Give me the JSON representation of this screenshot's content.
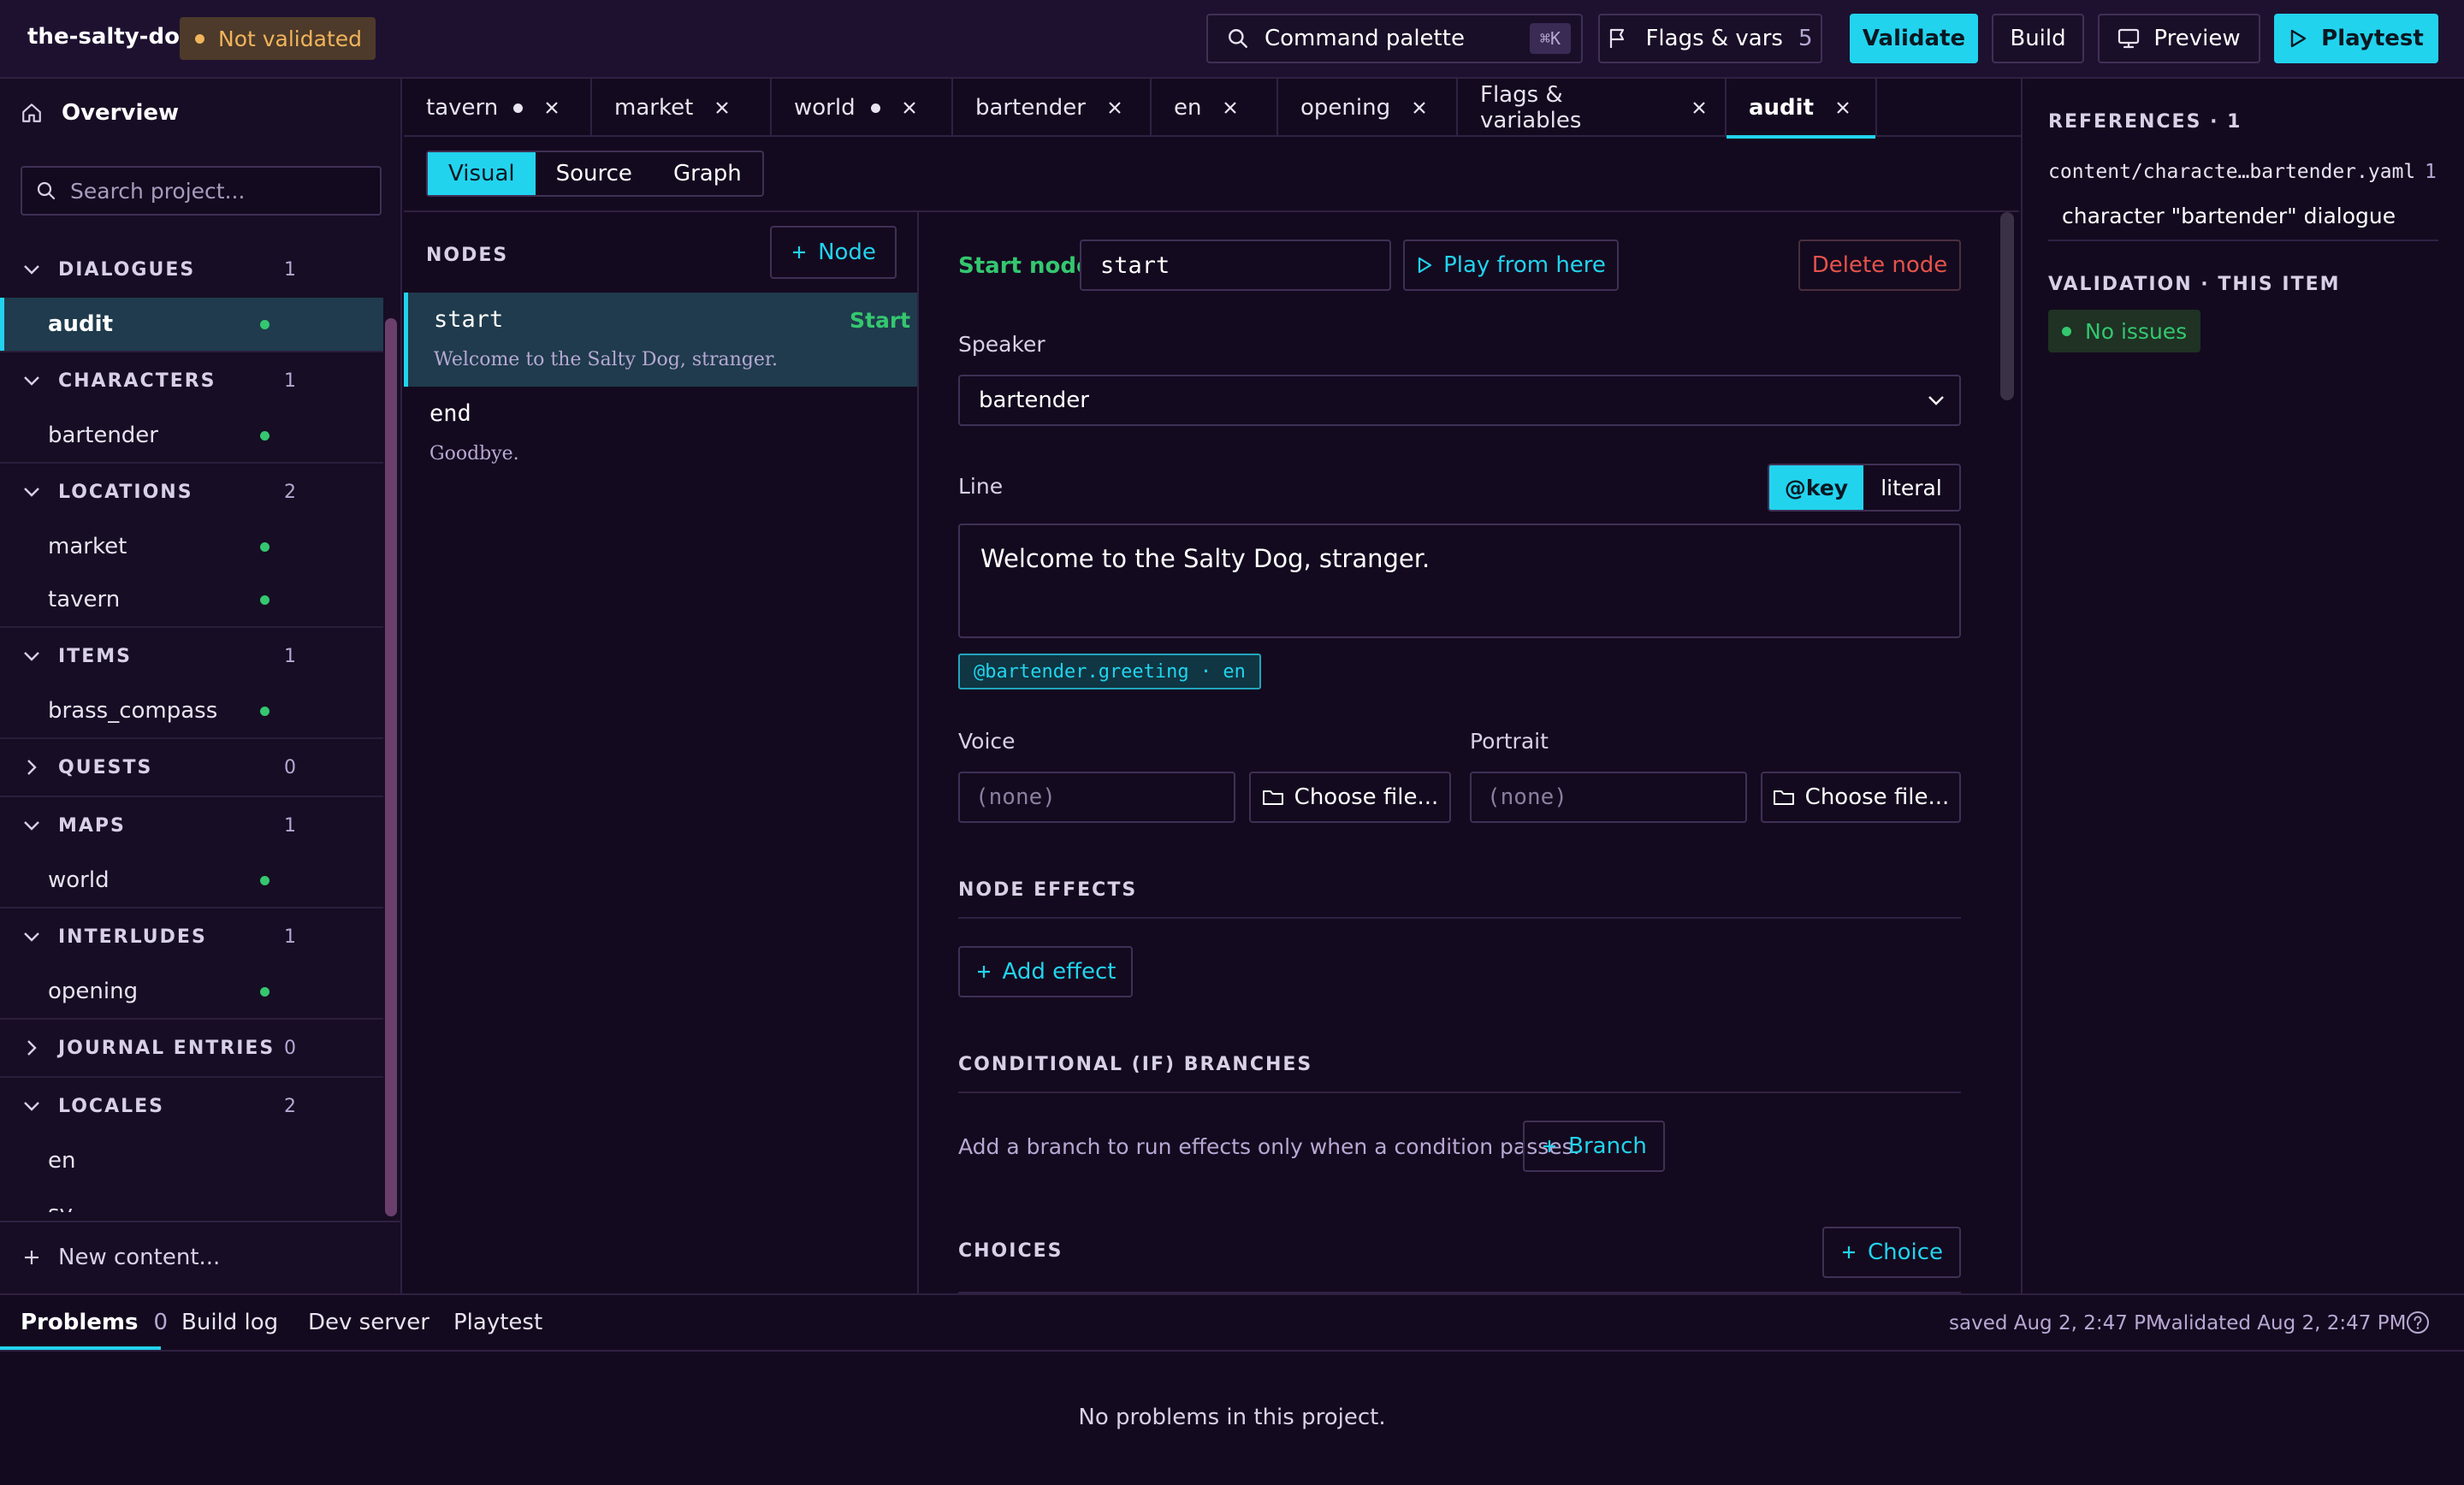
{
  "app": {
    "project_name": "the-salty-dog",
    "status_badge": "Not validated"
  },
  "toolbar": {
    "command_palette": "Command palette",
    "command_shortcut": "⌘K",
    "flags_label": "Flags & vars",
    "flags_count": "5",
    "validate_label": "Validate",
    "build_label": "Build",
    "preview_label": "Preview",
    "playtest_label": "Playtest"
  },
  "sidebar": {
    "overview": "Overview",
    "search_placeholder": "Search project...",
    "sections": [
      {
        "label": "DIALOGUES",
        "count": "1",
        "expanded": true,
        "items": [
          "audit"
        ]
      },
      {
        "label": "CHARACTERS",
        "count": "1",
        "expanded": true,
        "items": [
          "bartender"
        ]
      },
      {
        "label": "LOCATIONS",
        "count": "2",
        "expanded": true,
        "items": [
          "market",
          "tavern"
        ]
      },
      {
        "label": "ITEMS",
        "count": "1",
        "expanded": true,
        "items": [
          "brass_compass"
        ]
      },
      {
        "label": "QUESTS",
        "count": "0",
        "expanded": false,
        "items": []
      },
      {
        "label": "MAPS",
        "count": "1",
        "expanded": true,
        "items": [
          "world"
        ]
      },
      {
        "label": "INTERLUDES",
        "count": "1",
        "expanded": true,
        "items": [
          "opening"
        ]
      },
      {
        "label": "JOURNAL ENTRIES",
        "count": "0",
        "expanded": false,
        "items": []
      },
      {
        "label": "LOCALES",
        "count": "2",
        "expanded": true,
        "items": [
          "en",
          "sv"
        ]
      }
    ],
    "active_item": "audit",
    "new_content": "New content..."
  },
  "tabs": [
    {
      "label": "tavern",
      "modified": true
    },
    {
      "label": "market",
      "modified": false
    },
    {
      "label": "world",
      "modified": true
    },
    {
      "label": "bartender",
      "modified": false
    },
    {
      "label": "en",
      "modified": false
    },
    {
      "label": "opening",
      "modified": false
    },
    {
      "label": "Flags & variables",
      "modified": false
    },
    {
      "label": "audit",
      "modified": false,
      "active": true
    }
  ],
  "view_switch": [
    "Visual",
    "Source",
    "Graph"
  ],
  "nodes": {
    "header": "NODES",
    "add_label": "Node",
    "list": [
      {
        "name": "start",
        "line": "Welcome to the Salty Dog, stranger.",
        "tag": "Start"
      },
      {
        "name": "end",
        "line": "Goodbye.",
        "tag": ""
      }
    ]
  },
  "editor": {
    "start_node_label": "Start node",
    "start_node_value": "start",
    "play_from_here": "Play from here",
    "delete_node": "Delete node",
    "speaker_label": "Speaker",
    "speaker_value": "bartender",
    "line_label": "Line",
    "line_mode_key": "@key",
    "line_mode_literal": "literal",
    "line_text": "Welcome to the Salty Dog, stranger.",
    "line_key_chip": "@bartender.greeting · en",
    "voice_label": "Voice",
    "voice_value": "(none)",
    "portrait_label": "Portrait",
    "portrait_value": "(none)",
    "choose_file": "Choose file...",
    "node_effects_header": "NODE EFFECTS",
    "add_effect": "Add effect",
    "conditional_header": "CONDITIONAL (IF) BRANCHES",
    "conditional_help": "Add a branch to run effects only when a condition passes.",
    "branch_label": "Branch",
    "choices_header": "CHOICES",
    "choice_label": "Choice"
  },
  "references": {
    "header": "REFERENCES · 1",
    "file": "content/characte…bartender.yaml",
    "line": "1",
    "description": "character \"bartender\" dialogue",
    "validation_header": "VALIDATION · THIS ITEM",
    "validation_status": "No issues"
  },
  "bottom_panel": {
    "tabs": [
      "Problems",
      "Build log",
      "Dev server",
      "Playtest"
    ],
    "problems_count": "0",
    "saved": "saved Aug 2, 2:47 PM",
    "validated": "validated Aug 2, 2:47 PM",
    "message": "No problems in this project."
  },
  "colors": {
    "accent": "#22d3ee",
    "warning": "#f0b45c",
    "success": "#34c76f",
    "danger": "#e5534b",
    "background": "#140a1f"
  }
}
